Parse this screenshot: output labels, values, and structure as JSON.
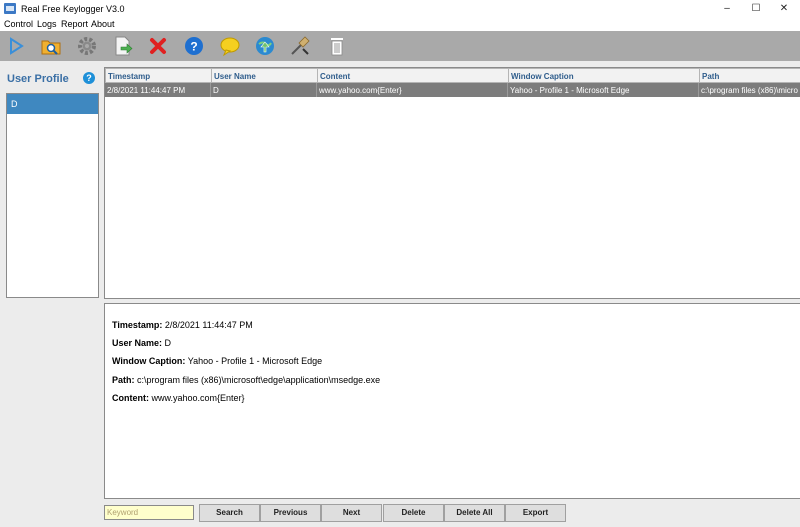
{
  "window": {
    "title": "Real Free Keylogger V3.0"
  },
  "menu": [
    "Control",
    "Logs",
    "Report",
    "About"
  ],
  "toolbar": [
    {
      "icon": "play-icon",
      "color": "#3a8fd9"
    },
    {
      "icon": "search-folder-icon",
      "color": "#e8a020"
    },
    {
      "icon": "gear-icon",
      "color": "#7a7a7a"
    },
    {
      "icon": "export-document-icon",
      "color": "#4caf50"
    },
    {
      "icon": "delete-x-icon",
      "color": "#e02020"
    },
    {
      "icon": "help-icon",
      "color": "#1e6fd0"
    },
    {
      "icon": "speech-bubble-icon",
      "color": "#f5d020"
    },
    {
      "icon": "globe-update-icon",
      "color": "#2b8ad0"
    },
    {
      "icon": "clean-tools-icon",
      "color": "#c0a060"
    },
    {
      "icon": "trash-icon",
      "color": "#ffffff"
    }
  ],
  "sidebar": {
    "title": "User Profile",
    "help_glyph": "?",
    "users": [
      "D"
    ]
  },
  "grid": {
    "columns": [
      "Timestamp",
      "User Name",
      "Content",
      "Window Caption",
      "Path"
    ],
    "rows": [
      [
        "2/8/2021 11:44:47 PM",
        "D",
        "www.yahoo.com{Enter}",
        "Yahoo - Profile 1 - Microsoft Edge",
        "c:\\program files (x86)\\micro"
      ]
    ]
  },
  "detail": {
    "timestamp_label": "Timestamp:",
    "timestamp": "2/8/2021 11:44:47 PM",
    "user_label": "User Name:",
    "user": "D",
    "caption_label": "Window Caption:",
    "caption": "Yahoo - Profile 1 - Microsoft Edge",
    "path_label": "Path:",
    "path": "c:\\program files (x86)\\microsoft\\edge\\application\\msedge.exe",
    "content_label": "Content:",
    "content": "www.yahoo.com{Enter}"
  },
  "bottom": {
    "keyword_placeholder": "Keyword",
    "buttons": [
      "Search",
      "Previous",
      "Next",
      "Delete",
      "Delete All",
      "Export"
    ]
  }
}
